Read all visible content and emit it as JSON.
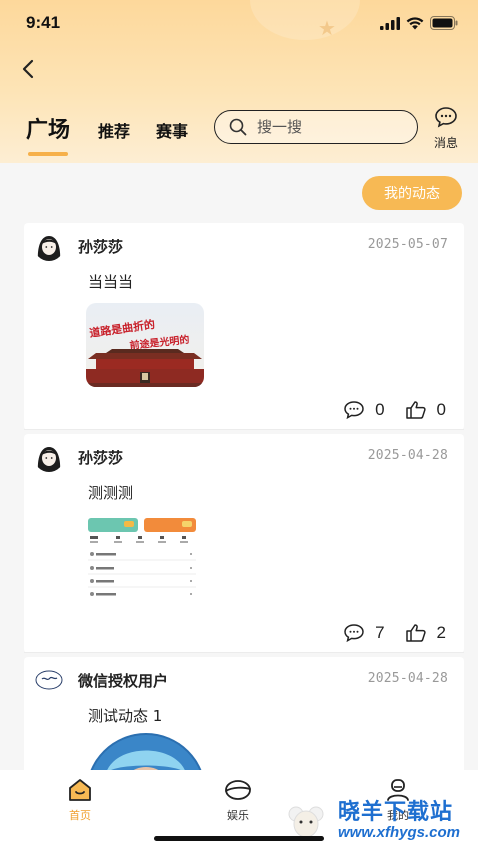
{
  "status_bar": {
    "time": "9:41"
  },
  "header": {
    "tabs": [
      {
        "label": "广场",
        "active": true
      },
      {
        "label": "推荐",
        "active": false
      },
      {
        "label": "赛事",
        "active": false
      }
    ],
    "search_placeholder": "搜一搜",
    "messages_label": "消息"
  },
  "my_posts_label": "我的动态",
  "posts": [
    {
      "user": "孙莎莎",
      "date": "2025-05-07",
      "text": "当当当",
      "comments": "0",
      "likes": "0",
      "image_text_1": "道路是曲折的",
      "image_text_2": "前途是光明的"
    },
    {
      "user": "孙莎莎",
      "date": "2025-04-28",
      "text": "测测测",
      "comments": "7",
      "likes": "2"
    },
    {
      "user": "微信授权用户",
      "date": "2025-04-28",
      "text": "测试动态 1"
    }
  ],
  "bottom_nav": [
    {
      "label": "首页",
      "icon": "home-icon",
      "active": true
    },
    {
      "label": "娱乐",
      "icon": "planet-icon",
      "active": false
    },
    {
      "label": "我的",
      "icon": "profile-icon",
      "active": false
    }
  ],
  "watermark": {
    "title": "晓羊下载站",
    "url": "www.xfhygs.com"
  },
  "colors": {
    "accent": "#f7b954",
    "header_top": "#fdd89b",
    "watermark": "#1e6fd0"
  }
}
